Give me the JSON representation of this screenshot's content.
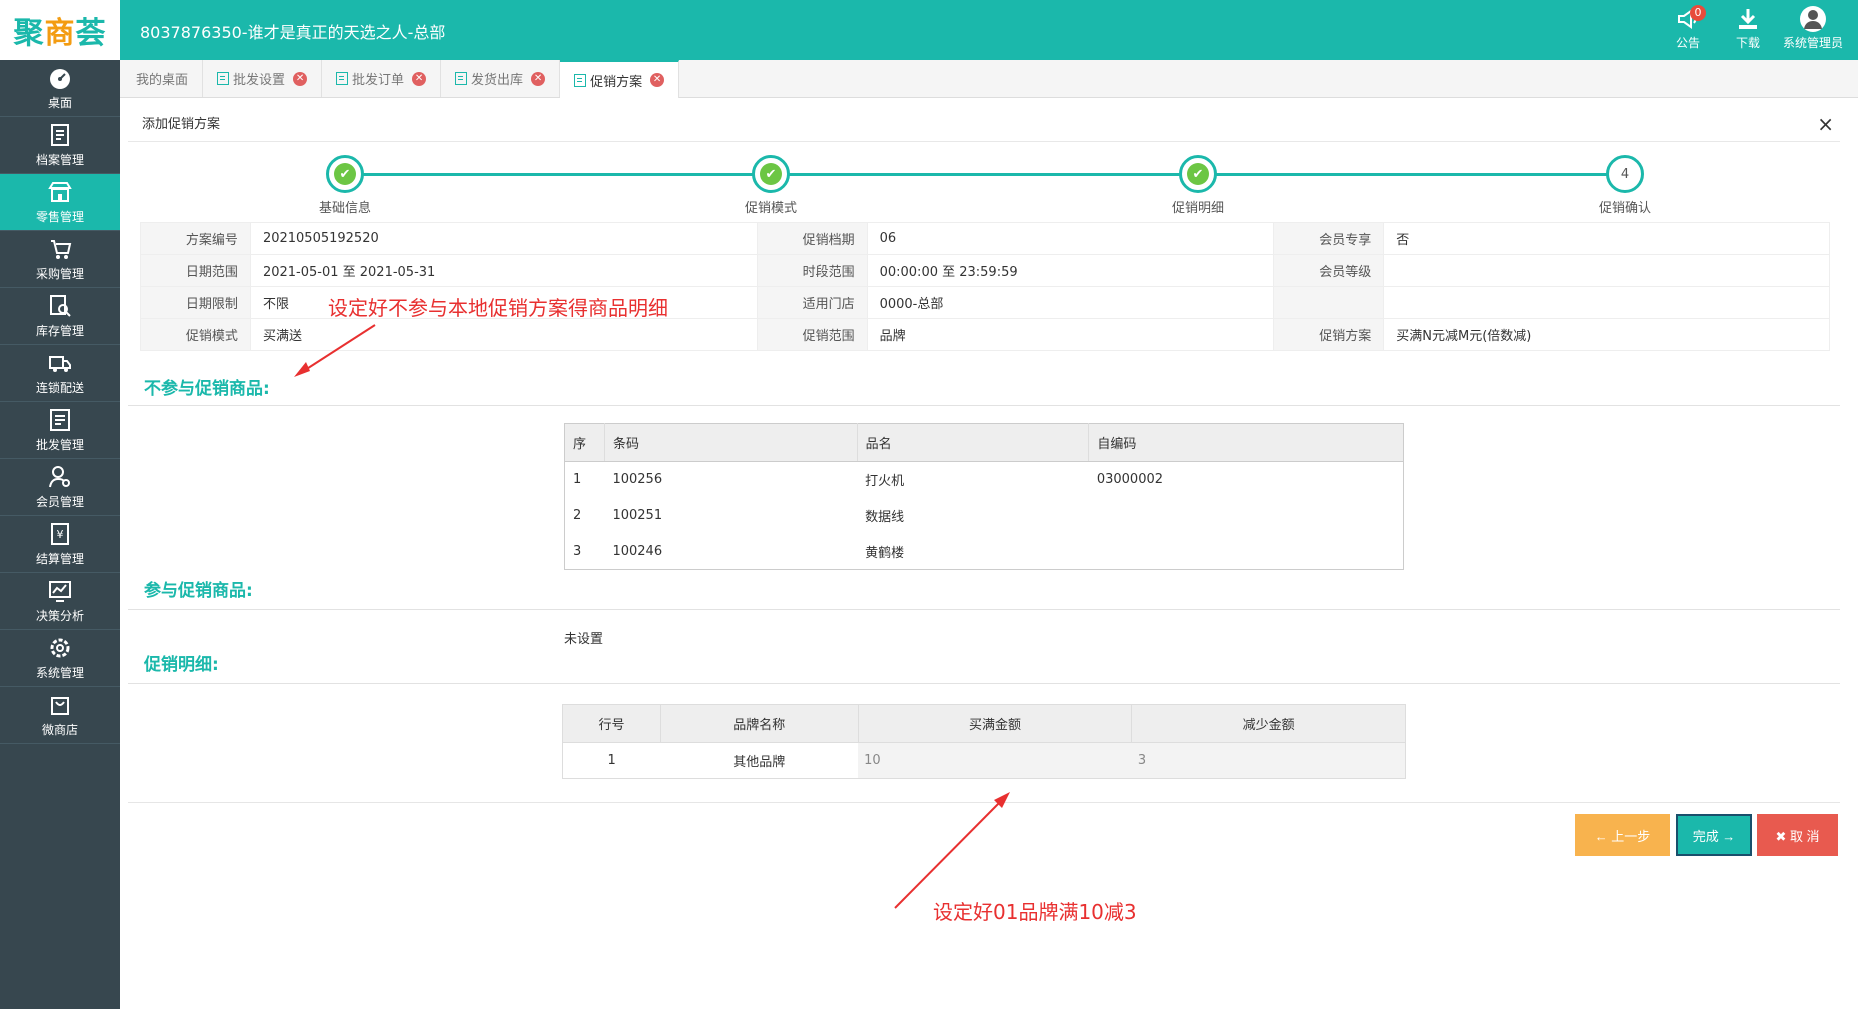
{
  "header": {
    "logo": {
      "chars": [
        "聚",
        "商",
        "荟"
      ]
    },
    "title": "8037876350-谁才是真正的天选之人-总部",
    "announce_label": "公告",
    "announce_badge": "0",
    "download_label": "下载",
    "user_label": "系统管理员"
  },
  "sidebar": {
    "items": [
      {
        "label": "桌面",
        "icon": "dashboard-icon"
      },
      {
        "label": "档案管理",
        "icon": "archive-icon"
      },
      {
        "label": "零售管理",
        "icon": "store-icon",
        "active": true
      },
      {
        "label": "采购管理",
        "icon": "purchase-icon"
      },
      {
        "label": "库存管理",
        "icon": "inventory-icon"
      },
      {
        "label": "连锁配送",
        "icon": "delivery-icon"
      },
      {
        "label": "批发管理",
        "icon": "wholesale-icon"
      },
      {
        "label": "会员管理",
        "icon": "member-icon"
      },
      {
        "label": "结算管理",
        "icon": "settlement-icon"
      },
      {
        "label": "决策分析",
        "icon": "analysis-icon"
      },
      {
        "label": "系统管理",
        "icon": "settings-icon"
      },
      {
        "label": "微商店",
        "icon": "shop-icon"
      }
    ]
  },
  "tabs": [
    {
      "label": "我的桌面"
    },
    {
      "label": "批发设置"
    },
    {
      "label": "批发订单"
    },
    {
      "label": "发货出库"
    },
    {
      "label": "促销方案",
      "active": true
    }
  ],
  "panel": {
    "title": "添加促销方案",
    "close": "×"
  },
  "steps": [
    {
      "label": "基础信息",
      "done": true
    },
    {
      "label": "促销模式",
      "done": true
    },
    {
      "label": "促销明细",
      "done": true
    },
    {
      "label": "促销确认",
      "number": "4"
    }
  ],
  "info": {
    "row1": {
      "k1": "方案编号",
      "v1": "20210505192520",
      "k2": "促销档期",
      "v2": "06",
      "k3": "会员专享",
      "v3": "否"
    },
    "row2": {
      "k1": "日期范围",
      "v1": "2021-05-01 至 2021-05-31",
      "k2": "时段范围",
      "v2": "00:00:00 至 23:59:59",
      "k3": "会员等级",
      "v3": ""
    },
    "row3": {
      "k1": "日期限制",
      "v1": "不限",
      "k2": "适用门店",
      "v2": "0000-总部",
      "k3": "",
      "v3": ""
    },
    "row4": {
      "k1": "促销模式",
      "v1": "买满送",
      "k2": "促销范围",
      "v2": "品牌",
      "k3": "促销方案",
      "v3": "买满N元减M元(倍数减)"
    }
  },
  "annotations": {
    "top": "设定好不参与本地促销方案得商品明细",
    "bottom": "设定好01品牌满10减3"
  },
  "excluded": {
    "title": "不参与促销商品:",
    "headers": {
      "seq": "序",
      "barcode": "条码",
      "name": "品名",
      "code": "自编码"
    },
    "rows": [
      {
        "seq": "1",
        "barcode": "100256",
        "name": "打火机",
        "code": "03000002"
      },
      {
        "seq": "2",
        "barcode": "100251",
        "name": "数据线",
        "code": ""
      },
      {
        "seq": "3",
        "barcode": "100246",
        "name": "黄鹤楼",
        "code": ""
      }
    ]
  },
  "included": {
    "title": "参与促销商品:",
    "empty_text": "未设置"
  },
  "detail": {
    "title": "促销明细:",
    "headers": {
      "row": "行号",
      "brand": "品牌名称",
      "amount": "买满金额",
      "reduce": "减少金额"
    },
    "rows": [
      {
        "row": "1",
        "brand": "其他品牌",
        "amount": "10",
        "reduce": "3"
      }
    ]
  },
  "buttons": {
    "prev": "← 上一步",
    "done": "完成 →",
    "cancel": "✖ 取 消"
  },
  "colors": {
    "primary": "#1bb8ab",
    "sidebar": "#37474f",
    "prev": "#f8b34e",
    "cancel": "#e85a4f",
    "annotation": "#e83030"
  }
}
